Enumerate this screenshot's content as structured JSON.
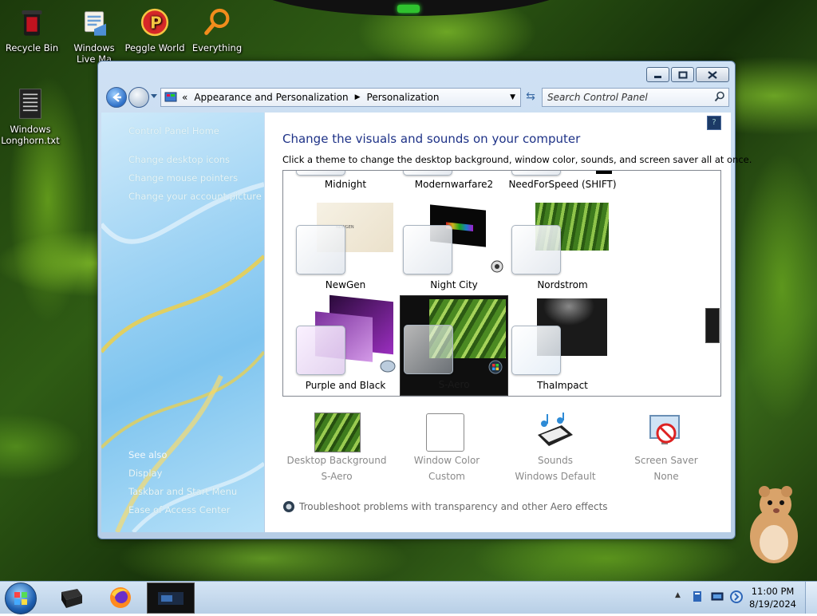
{
  "desktop": {
    "icons": [
      {
        "label": "Recycle Bin",
        "icon": "recycle-bin-icon"
      },
      {
        "label": "Windows Live Ma",
        "icon": "mail-icon"
      },
      {
        "label": "Peggle World",
        "icon": "peggle-icon"
      },
      {
        "label": "Everything",
        "icon": "search-magnifier-icon"
      },
      {
        "label": "Windows Longhorn.txt",
        "icon": "text-file-icon"
      }
    ]
  },
  "window": {
    "breadcrumb": [
      "Appearance and Personalization",
      "Personalization"
    ],
    "breadcrumb_prefix": "«",
    "search_placeholder": "Search Control Panel",
    "sidebar": {
      "home_link": "Control Panel Home",
      "links": [
        "Change desktop icons",
        "Change mouse pointers",
        "Change your account picture"
      ],
      "see_also_label": "See also",
      "see_also_links": [
        "Display",
        "Taskbar and Start Menu",
        "Ease of Access Center"
      ]
    },
    "main": {
      "title": "Change the visuals and sounds on your computer",
      "description": "Click a theme to change the desktop background, window color, sounds, and screen saver all at once.",
      "themes": [
        {
          "name": "Midnight"
        },
        {
          "name": "Modernwarfare2"
        },
        {
          "name": "NeedForSpeed (SHIFT)"
        },
        {
          "name": "NewGen"
        },
        {
          "name": "Night City"
        },
        {
          "name": "Nordstrom"
        },
        {
          "name": "Purple and Black"
        },
        {
          "name": "S-Aero",
          "selected": true
        },
        {
          "name": "ThaImpact"
        }
      ],
      "settings": [
        {
          "label": "Desktop Background",
          "value": "S-Aero"
        },
        {
          "label": "Window Color",
          "value": "Custom"
        },
        {
          "label": "Sounds",
          "value": "Windows Default"
        },
        {
          "label": "Screen Saver",
          "value": "None"
        }
      ],
      "troubleshoot_link": "Troubleshoot problems with transparency and other Aero effects"
    }
  },
  "taskbar": {
    "pinned": [
      "monitor-icon",
      "firefox-icon",
      "control-panel-window-thumbnail"
    ],
    "clock": {
      "time": "11:00 PM",
      "date": "8/19/2024"
    }
  }
}
